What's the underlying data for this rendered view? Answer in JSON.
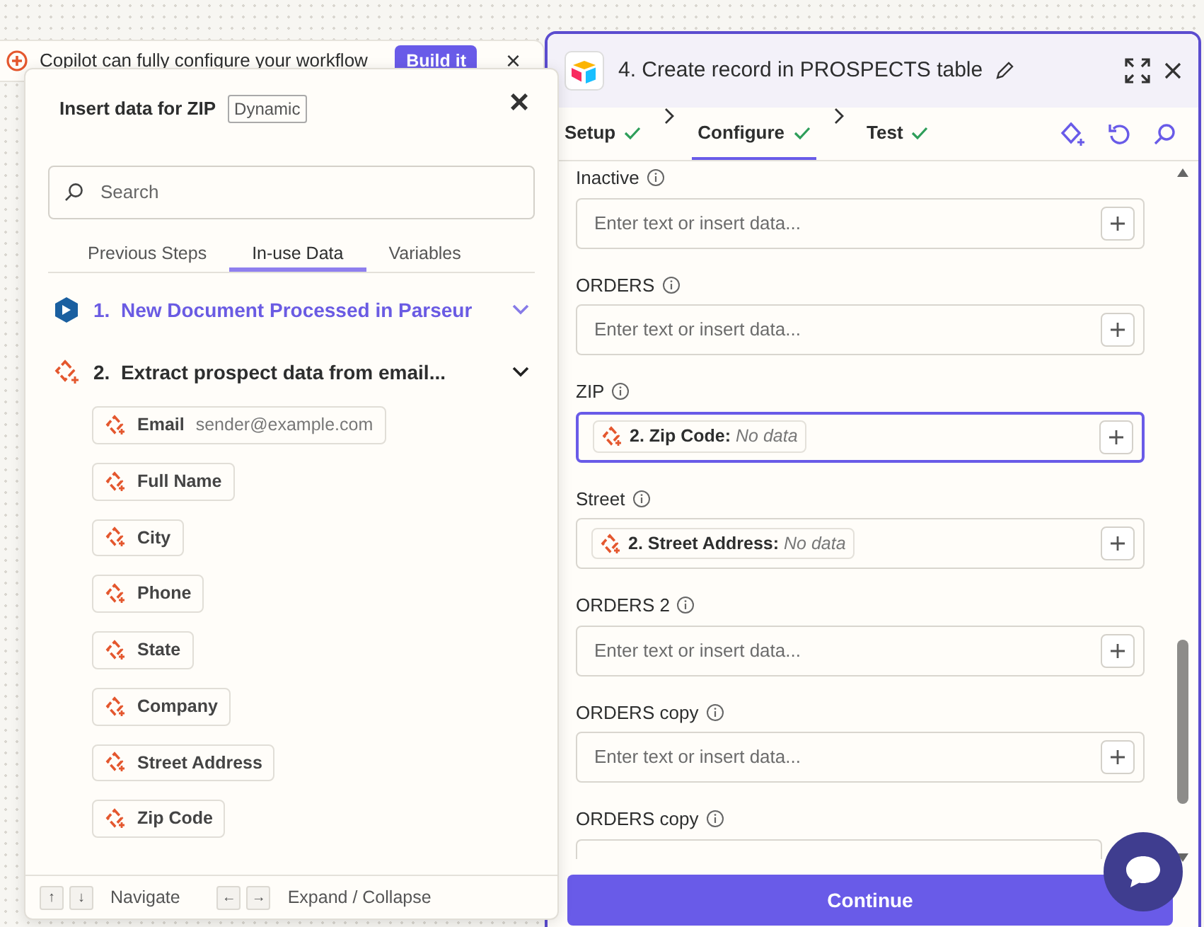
{
  "copilot_banner": {
    "text": "Copilot can fully configure your workflow",
    "button": "Build it",
    "close": "×"
  },
  "insert_popover": {
    "title": "Insert data for ZIP",
    "badge": "Dynamic",
    "close": "×",
    "search": {
      "placeholder": "Search"
    },
    "tabs": [
      {
        "label": "Previous Steps",
        "selected": false
      },
      {
        "label": "In-use Data",
        "selected": true
      },
      {
        "label": "Variables",
        "selected": false
      }
    ],
    "steps": [
      {
        "number": "1.",
        "title": "New Document Processed in Parseur",
        "kind": "parseur",
        "highlighted": true,
        "expanded": false
      },
      {
        "number": "2.",
        "title": "Extract prospect data from email...",
        "kind": "ai",
        "highlighted": false,
        "expanded": true,
        "items": [
          {
            "label": "Email",
            "value": "sender@example.com"
          },
          {
            "label": "Full Name"
          },
          {
            "label": "City"
          },
          {
            "label": "Phone"
          },
          {
            "label": "State"
          },
          {
            "label": "Company"
          },
          {
            "label": "Street Address"
          },
          {
            "label": "Zip Code"
          }
        ]
      }
    ],
    "footer": [
      {
        "keys": [
          "↑",
          "↓"
        ],
        "label": "Navigate"
      },
      {
        "keys": [
          "←",
          "→"
        ],
        "label": "Expand / Collapse"
      }
    ]
  },
  "step_panel": {
    "title": "4. Create record in PROSPECTS table",
    "tabs": [
      {
        "label": "Setup",
        "selected": false,
        "done": true
      },
      {
        "label": "Configure",
        "selected": true,
        "done": true
      },
      {
        "label": "Test",
        "selected": false,
        "done": true
      }
    ],
    "fields": [
      {
        "label": "Inactive",
        "kind": "empty",
        "placeholder": "Enter text or insert data...",
        "focused": false
      },
      {
        "label": "ORDERS",
        "kind": "empty",
        "placeholder": "Enter text or insert data...",
        "focused": false
      },
      {
        "label": "ZIP",
        "kind": "token",
        "token": "2. Zip Code:",
        "token_value": "No data",
        "focused": true
      },
      {
        "label": "Street",
        "kind": "token",
        "token": "2. Street Address:",
        "token_value": "No data",
        "focused": false
      },
      {
        "label": "ORDERS 2",
        "kind": "empty",
        "placeholder": "Enter text or insert data...",
        "focused": false
      },
      {
        "label": "ORDERS copy",
        "kind": "empty",
        "placeholder": "Enter text or insert data...",
        "focused": false
      },
      {
        "label": "ORDERS copy",
        "kind": "cut",
        "focused": false
      }
    ],
    "continue_button": "Continue"
  }
}
